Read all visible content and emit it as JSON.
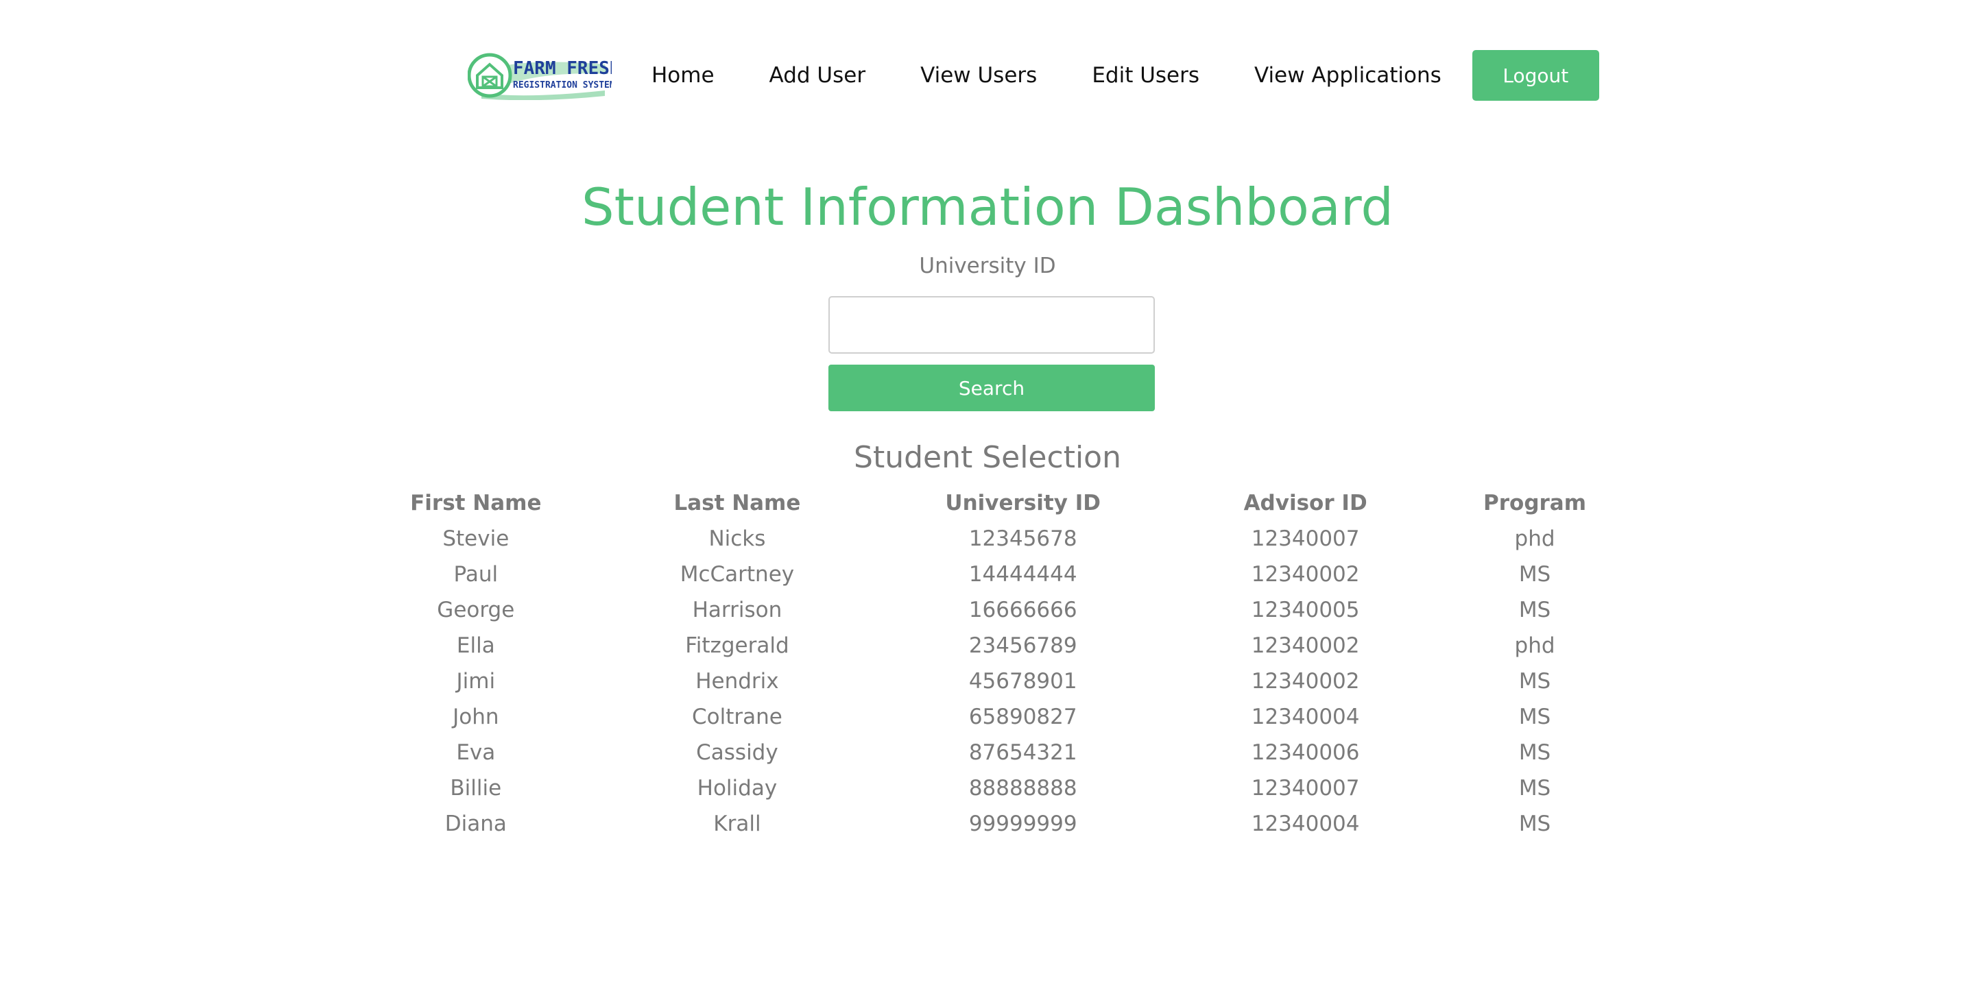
{
  "logo": {
    "line1": "FARM FRESH",
    "line2": "REGISTRATION SYSTEM"
  },
  "nav": {
    "home": "Home",
    "add_user": "Add User",
    "view_users": "View Users",
    "edit_users": "Edit Users",
    "view_applications": "View Applications",
    "logout": "Logout"
  },
  "page": {
    "title": "Student Information Dashboard",
    "uid_label": "University ID",
    "uid_value": "",
    "search_label": "Search",
    "section_title": "Student Selection"
  },
  "table": {
    "headers": [
      "First Name",
      "Last Name",
      "University ID",
      "Advisor ID",
      "Program"
    ],
    "rows": [
      [
        "Stevie",
        "Nicks",
        "12345678",
        "12340007",
        "phd"
      ],
      [
        "Paul",
        "McCartney",
        "14444444",
        "12340002",
        "MS"
      ],
      [
        "George",
        "Harrison",
        "16666666",
        "12340005",
        "MS"
      ],
      [
        "Ella",
        "Fitzgerald",
        "23456789",
        "12340002",
        "phd"
      ],
      [
        "Jimi",
        "Hendrix",
        "45678901",
        "12340002",
        "MS"
      ],
      [
        "John",
        "Coltrane",
        "65890827",
        "12340004",
        "MS"
      ],
      [
        "Eva",
        "Cassidy",
        "87654321",
        "12340006",
        "MS"
      ],
      [
        "Billie",
        "Holiday",
        "88888888",
        "12340007",
        "MS"
      ],
      [
        "Diana",
        "Krall",
        "99999999",
        "12340004",
        "MS"
      ]
    ]
  },
  "colors": {
    "accent": "#52c07a",
    "text_muted": "#7a7a7a",
    "nav_text": "#111111",
    "logo_blue": "#1f3f9a"
  }
}
